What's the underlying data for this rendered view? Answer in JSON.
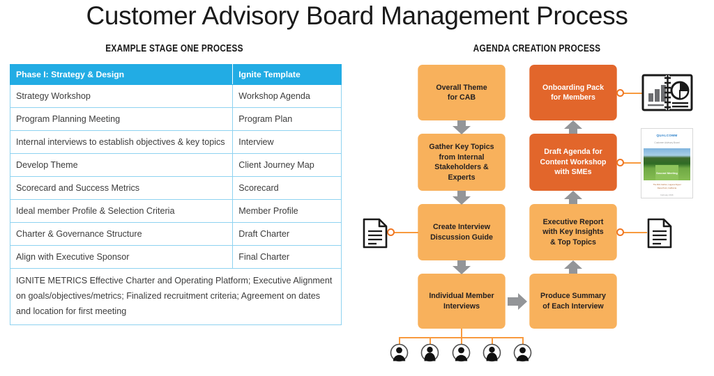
{
  "page": {
    "title": "Customer Advisory Board Management Process"
  },
  "left_panel": {
    "section_title": "EXAMPLE STAGE ONE PROCESS",
    "table": {
      "headers": [
        "Phase I: Strategy & Design",
        "Ignite Template"
      ],
      "rows": [
        [
          "Strategy Workshop",
          "Workshop Agenda"
        ],
        [
          "Program Planning Meeting",
          "Program Plan"
        ],
        [
          "Internal interviews to establish objectives & key topics",
          "Interview"
        ],
        [
          "Develop Theme",
          "Client Journey Map"
        ],
        [
          "Scorecard and Success Metrics",
          "Scorecard"
        ],
        [
          "Ideal member Profile & Selection Criteria",
          "Member Profile"
        ],
        [
          "Charter & Governance Structure",
          "Draft Charter"
        ],
        [
          "Align with Executive Sponsor",
          "Final Charter"
        ]
      ],
      "footer_note": "IGNITE METRICS Effective Charter and Operating Platform; Executive Alignment on goals/objectives/metrics; Finalized recruitment criteria; Agreement on dates and location for first meeting",
      "header_color": "#22ace4",
      "border_color": "#8ed2f0"
    }
  },
  "right_panel": {
    "section_title": "AGENDA CREATION PROCESS",
    "colors": {
      "light_box": "#f8b15c",
      "dark_box": "#e2662b",
      "arrow": "#939598",
      "connector": "#f89a3e",
      "connector_dot": "#ef7622"
    },
    "nodes": [
      {
        "id": "overall-theme",
        "label": "Overall Theme\nfor CAB",
        "style": "light"
      },
      {
        "id": "gather-key-topics",
        "label": "Gather Key Topics\nfrom Internal\nStakeholders & Experts",
        "style": "light"
      },
      {
        "id": "create-interview",
        "label": "Create Interview\nDiscussion Guide",
        "style": "light"
      },
      {
        "id": "individual-member",
        "label": "Individual Member\nInterviews",
        "style": "light"
      },
      {
        "id": "produce-summary",
        "label": "Produce Summary\nof Each Interview",
        "style": "light"
      },
      {
        "id": "executive-report",
        "label": "Executive Report\nwith Key Insights\n& Top Topics",
        "style": "light"
      },
      {
        "id": "draft-agenda",
        "label": "Draft Agenda for\nContent Workshop\nwith SMEs",
        "style": "dark"
      },
      {
        "id": "onboarding-pack",
        "label": "Onboarding Pack\nfor Members",
        "style": "dark"
      }
    ],
    "attachments": [
      {
        "id": "interview-guide-doc",
        "icon": "document-icon",
        "attached_to": "create-interview"
      },
      {
        "id": "executive-report-doc",
        "icon": "document-icon",
        "attached_to": "executive-report"
      },
      {
        "id": "agenda-deck",
        "icon": "presentation-cover",
        "attached_to": "draft-agenda"
      },
      {
        "id": "onboarding-binder",
        "icon": "binder-chart-icon",
        "attached_to": "onboarding-pack"
      }
    ],
    "members": {
      "count": 5,
      "genders": [
        "male",
        "female",
        "male",
        "female",
        "male"
      ]
    },
    "doc_thumb": {
      "logo": "QUALCOMM",
      "subtitle": "Customer Advisory Board",
      "caption": "Second Meeting",
      "footer": "The Ritz-Carlton, Laguna Niguel\nDana Point, California",
      "date": "February 2016"
    }
  }
}
